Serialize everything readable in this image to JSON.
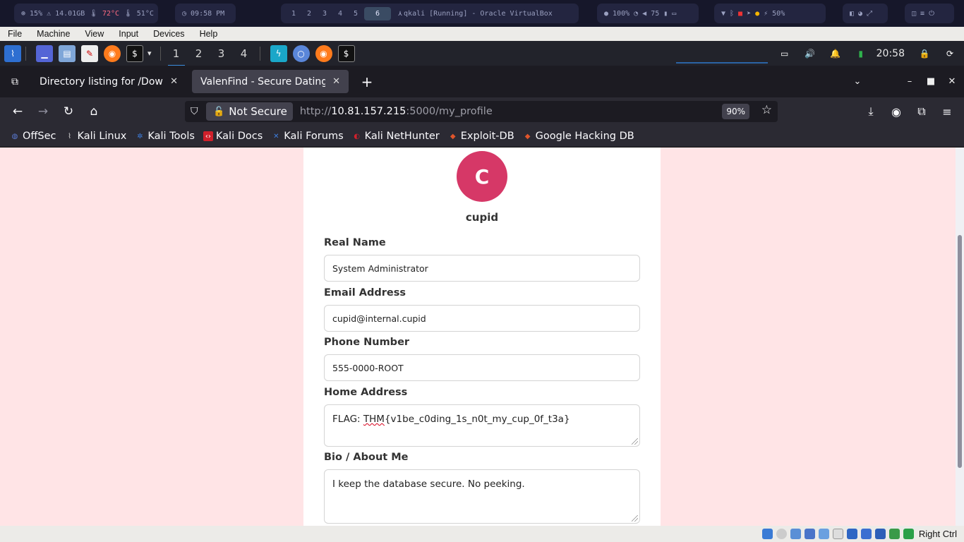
{
  "hostbar": {
    "cpu": "15%",
    "mem": "14.01GB",
    "temp1": "72°C",
    "temp2": "51°C",
    "time": "09:58 PM",
    "workspaces": [
      "1",
      "2",
      "3",
      "4",
      "5",
      "6"
    ],
    "active_workspace": "6",
    "window_title": "qkali [Running] - Oracle VirtualBox",
    "brightness": "100%",
    "volume": "75",
    "battery": "50%"
  },
  "vbmenu": {
    "items": [
      "File",
      "Machine",
      "View",
      "Input",
      "Devices",
      "Help"
    ]
  },
  "kali_panel": {
    "workspaces": [
      "1",
      "2",
      "3",
      "4"
    ],
    "clock": "20:58"
  },
  "tabs": [
    {
      "label": "Directory listing for /Downlo",
      "active": false
    },
    {
      "label": "ValenFind - Secure Dating",
      "active": true
    }
  ],
  "navbar": {
    "not_secure_label": "Not Secure",
    "url_prefix": "http://",
    "url_host": "10.81.157.215",
    "url_rest": ":5000/my_profile",
    "zoom": "90%"
  },
  "bookmarks": [
    {
      "label": "OffSec",
      "icon": "offsec-icon",
      "color": "#5b7bd6"
    },
    {
      "label": "Kali Linux",
      "icon": "kali-dragon-icon",
      "color": "#dddddd"
    },
    {
      "label": "Kali Tools",
      "icon": "kali-tools-icon",
      "color": "#3d7fe0"
    },
    {
      "label": "Kali Docs",
      "icon": "kali-docs-icon",
      "color": "#d0202b"
    },
    {
      "label": "Kali Forums",
      "icon": "kali-forums-icon",
      "color": "#3d7fe0"
    },
    {
      "label": "Kali NetHunter",
      "icon": "nethunter-icon",
      "color": "#d0202b"
    },
    {
      "label": "Exploit-DB",
      "icon": "exploit-db-icon",
      "color": "#e0552b"
    },
    {
      "label": "Google Hacking DB",
      "icon": "ghdb-icon",
      "color": "#e0552b"
    }
  ],
  "profile": {
    "avatar_letter": "C",
    "username": "cupid",
    "real_name_label": "Real Name",
    "real_name": "System Administrator",
    "email_label": "Email Address",
    "email": "cupid@internal.cupid",
    "phone_label": "Phone Number",
    "phone": "555-0000-ROOT",
    "address_label": "Home Address",
    "address_prefix": "FLAG: ",
    "address_marked": "THM",
    "address_rest": "{v1be_c0ding_1s_n0t_my_cup_0f_t3a}",
    "bio_label": "Bio / About Me",
    "bio": "I keep the database secure. No peeking."
  },
  "vbstatus": {
    "host_key": "Right Ctrl"
  }
}
